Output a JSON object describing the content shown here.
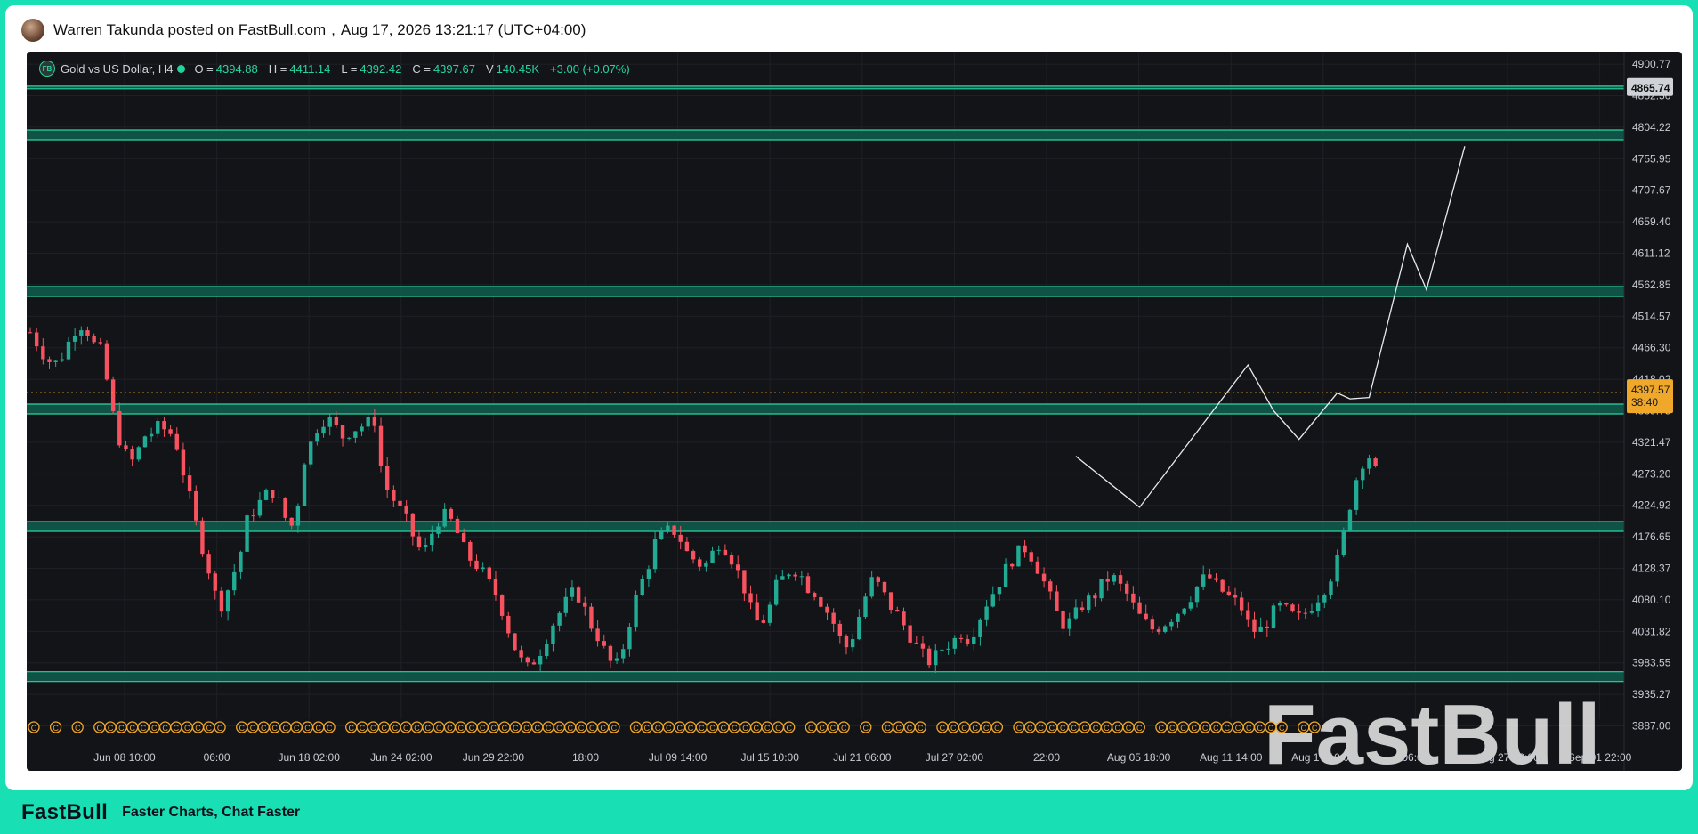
{
  "post": {
    "author_line": "Warren Takunda posted on FastBull.com",
    "separator": ",",
    "timestamp": "Aug 17, 2026 13:21:17 (UTC+04:00)"
  },
  "legend": {
    "symbol": "Gold vs US Dollar, H4",
    "open_label": "O =",
    "open": "4394.88",
    "high_label": "H =",
    "high": "4411.14",
    "low_label": "L =",
    "low": "4392.42",
    "close_label": "C =",
    "close": "4397.67",
    "volume_label": "V",
    "volume": "140.45K",
    "change": "+3.00 (+0.07%)"
  },
  "colors": {
    "background": "#131418",
    "up": "#22ab94",
    "down": "#f7525f",
    "zone_fill": "#0e5e4e",
    "zone_border": "#2bd4a4",
    "price_tag": "#f0a82a",
    "event_marker": "#f0a82a",
    "brand": "#18e0b4"
  },
  "chart_data": {
    "type": "candlestick",
    "symbol": "Gold vs US Dollar",
    "timeframe": "H4",
    "ylim": [
      3870,
      4920
    ],
    "y_ticks": [
      "4900.77",
      "4852.50",
      "4804.22",
      "4755.95",
      "4707.67",
      "4659.40",
      "4611.12",
      "4562.85",
      "4514.57",
      "4466.30",
      "4418.02",
      "4369.75",
      "4321.47",
      "4273.20",
      "4224.92",
      "4176.65",
      "4128.37",
      "4080.10",
      "4031.82",
      "3983.55",
      "3935.27",
      "3887.00"
    ],
    "x_ticks": [
      "Jun 08 10:00",
      "06:00",
      "Jun 18 02:00",
      "Jun 24 02:00",
      "Jun 29 22:00",
      "18:00",
      "Jul 09 14:00",
      "Jul 15 10:00",
      "Jul 21 06:00",
      "Jul 27 02:00",
      "22:00",
      "Aug 05 18:00",
      "Aug 11 14:00",
      "Aug 17 10:00",
      "06:00",
      "Aug 27 02:00",
      "Sep 01 22:00"
    ],
    "price_path": [
      4490,
      4470,
      4450,
      4440,
      4455,
      4480,
      4505,
      4495,
      4470,
      4460,
      4380,
      4330,
      4300,
      4290,
      4330,
      4335,
      4345,
      4340,
      4330,
      4280,
      4230,
      4180,
      4140,
      4090,
      4070,
      4110,
      4140,
      4200,
      4220,
      4235,
      4250,
      4230,
      4200,
      4190,
      4290,
      4320,
      4350,
      4360,
      4345,
      4330,
      4340,
      4345,
      4350,
      4355,
      4260,
      4240,
      4220,
      4200,
      4170,
      4150,
      4180,
      4205,
      4210,
      4190,
      4160,
      4140,
      4130,
      4110,
      4090,
      4060,
      4020,
      3990,
      3975,
      3990,
      4010,
      4040,
      4060,
      4080,
      4095,
      4070,
      4040,
      4020,
      3990,
      3975,
      4010,
      4060,
      4100,
      4130,
      4170,
      4180,
      4190,
      4175,
      4150,
      4140,
      4130,
      4150,
      4170,
      4155,
      4130,
      4100,
      4060,
      4040,
      4060,
      4100,
      4115,
      4130,
      4120,
      4100,
      4090,
      4070,
      4050,
      4020,
      4005,
      4040,
      4080,
      4110,
      4100,
      4075,
      4060,
      4040,
      4020,
      4000,
      3985,
      3995,
      4010,
      4015,
      4030,
      4020,
      4040,
      4070,
      4090,
      4110,
      4135,
      4150,
      4160,
      4145,
      4120,
      4090,
      4060,
      4040,
      4050,
      4070,
      4080,
      4090,
      4110,
      4115,
      4100,
      4085,
      4060,
      4045,
      4035,
      4040,
      4050,
      4060,
      4075,
      4090,
      4110,
      4115,
      4100,
      4090,
      4080,
      4070,
      4040,
      4030,
      4040,
      4060,
      4070,
      4060,
      4050,
      4060,
      4075,
      4090,
      4110,
      4140,
      4190,
      4250,
      4290,
      4300,
      4270,
      4240,
      4230,
      4260,
      4290,
      4330,
      4360,
      4355,
      4380,
      4390,
      4385,
      4410,
      4440,
      4430,
      4400,
      4390,
      4420,
      4450,
      4440,
      4410,
      4390,
      4380,
      4360,
      4330,
      4320,
      4350,
      4370,
      4390,
      4400,
      4395,
      4398
    ],
    "zones": [
      {
        "low": 4863,
        "high": 4867,
        "label": "4865.74"
      },
      {
        "low": 4785,
        "high": 4800
      },
      {
        "low": 4545,
        "high": 4560
      },
      {
        "low": 4365,
        "high": 4380
      },
      {
        "low": 4185,
        "high": 4200
      },
      {
        "low": 3955,
        "high": 3970
      }
    ],
    "current_price": {
      "price": "4397.57",
      "countdown": "38:40"
    },
    "projection_path": [
      {
        "bar": 164,
        "price": 4300
      },
      {
        "bar": 174,
        "price": 4222
      },
      {
        "bar": 191,
        "price": 4440
      },
      {
        "bar": 195,
        "price": 4370
      },
      {
        "bar": 199,
        "price": 4326
      },
      {
        "bar": 205,
        "price": 4397
      },
      {
        "bar": 207,
        "price": 4388
      },
      {
        "bar": 210,
        "price": 4390
      },
      {
        "bar": 216,
        "price": 4625
      },
      {
        "bar": 219,
        "price": 4555
      },
      {
        "bar": 225,
        "price": 4775
      }
    ],
    "event_marker_glyph": "C",
    "watermark": "FastBull"
  },
  "footer": {
    "logo": "FastBull",
    "tagline": "Faster Charts, Chat Faster"
  }
}
